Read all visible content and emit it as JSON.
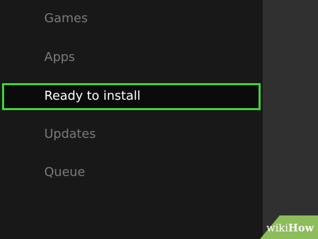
{
  "sidebar": {
    "items": [
      {
        "label": "Games"
      },
      {
        "label": "Apps"
      },
      {
        "label": "Ready to install"
      },
      {
        "label": "Updates"
      },
      {
        "label": "Queue"
      }
    ],
    "selected_index": 2
  },
  "colors": {
    "background": "#181818",
    "right_panel": "#303030",
    "inactive_text": "#7a7a7a",
    "selected_text": "#ffffff",
    "highlight_border": "#3fd43a",
    "watermark_bg": "#8dbc5a"
  },
  "watermark": {
    "prefix": "wiki",
    "suffix": "How"
  }
}
